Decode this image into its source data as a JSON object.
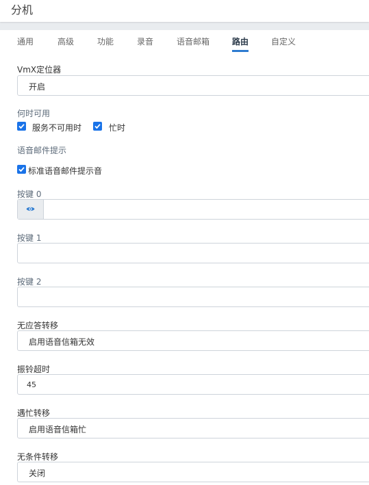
{
  "header": {
    "title": "分机"
  },
  "tabs": [
    {
      "label": "通用"
    },
    {
      "label": "高级"
    },
    {
      "label": "功能"
    },
    {
      "label": "录音"
    },
    {
      "label": "语音邮箱"
    },
    {
      "label": "路由",
      "active": true
    },
    {
      "label": "自定义"
    }
  ],
  "form": {
    "vmx_locator": {
      "label": "VmX定位器",
      "value": "开启"
    },
    "when_available": {
      "label": "何时可用",
      "options": [
        {
          "label": "服务不可用时",
          "checked": true
        },
        {
          "label": "忙时",
          "checked": true
        }
      ]
    },
    "vm_prompt": {
      "label": "语音邮件提示",
      "option": {
        "label": "标准语音邮件提示音",
        "checked": true
      }
    },
    "key0": {
      "label": "按键 0",
      "value": ""
    },
    "key1": {
      "label": "按键 1",
      "value": ""
    },
    "key2": {
      "label": "按键 2",
      "value": ""
    },
    "no_answer": {
      "label": "无应答转移",
      "value": "启用语音信箱无效"
    },
    "ring_timeout": {
      "label": "振铃超时",
      "value": "45"
    },
    "busy": {
      "label": "遇忙转移",
      "value": "启用语音信箱忙"
    },
    "unconditional": {
      "label": "无条件转移",
      "value": "关闭"
    }
  },
  "colors": {
    "accent": "#2d7bd0",
    "checkbox": "#1a73e8"
  },
  "icons": {
    "reveal": "eye-icon",
    "check": "check-icon"
  }
}
